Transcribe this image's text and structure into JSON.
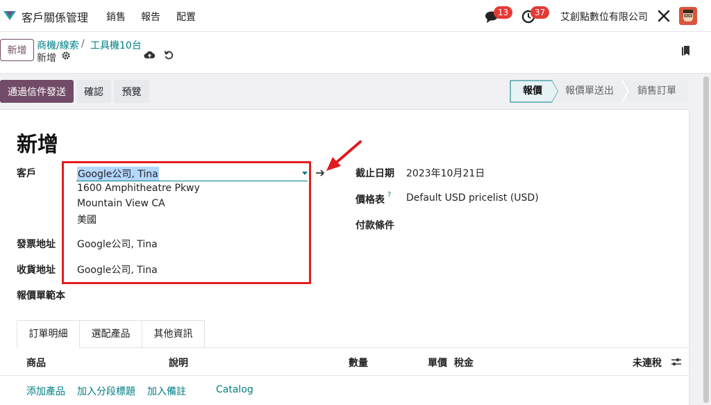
{
  "navbar": {
    "app_name": "客戶關係管理",
    "menu": [
      "銷售",
      "報告",
      "配置"
    ],
    "messages_count": "13",
    "activities_count": "37",
    "company": "艾創點數位有限公司"
  },
  "control": {
    "new_label": "新增",
    "breadcrumb": [
      "商機/線索",
      "工具機10台"
    ],
    "breadcrumb_sep": "/",
    "current": "新增"
  },
  "actions": {
    "send_email": "通過信件發送",
    "confirm": "確認",
    "preview": "預覽"
  },
  "status_steps": [
    "報價",
    "報價單送出",
    "銷售訂單"
  ],
  "form": {
    "title": "新增",
    "customer_label": "客戶",
    "customer_value": "Google公司, Tina",
    "customer_address": [
      "1600 Amphitheatre Pkwy",
      "Mountain View CA",
      "美國"
    ],
    "invoice_label": "發票地址",
    "invoice_value": "Google公司, Tina",
    "delivery_label": "收貨地址",
    "delivery_value": "Google公司, Tina",
    "template_label": "報價單範本",
    "expiry_label": "截止日期",
    "expiry_value": "2023年10月21日",
    "pricelist_label": "價格表",
    "pricelist_help": "?",
    "pricelist_value": "Default USD pricelist (USD)",
    "payment_label": "付款條件"
  },
  "tabs": [
    "訂單明細",
    "選配產品",
    "其他資訊"
  ],
  "columns": [
    "商品",
    "說明",
    "數量",
    "單價",
    "稅金",
    "未連稅"
  ],
  "links": [
    "添加產品",
    "加入分段標題",
    "加入備註",
    "Catalog"
  ],
  "colors": {
    "brand": "#714b67",
    "accent": "#017e84",
    "annotation": "#e21c1c"
  }
}
